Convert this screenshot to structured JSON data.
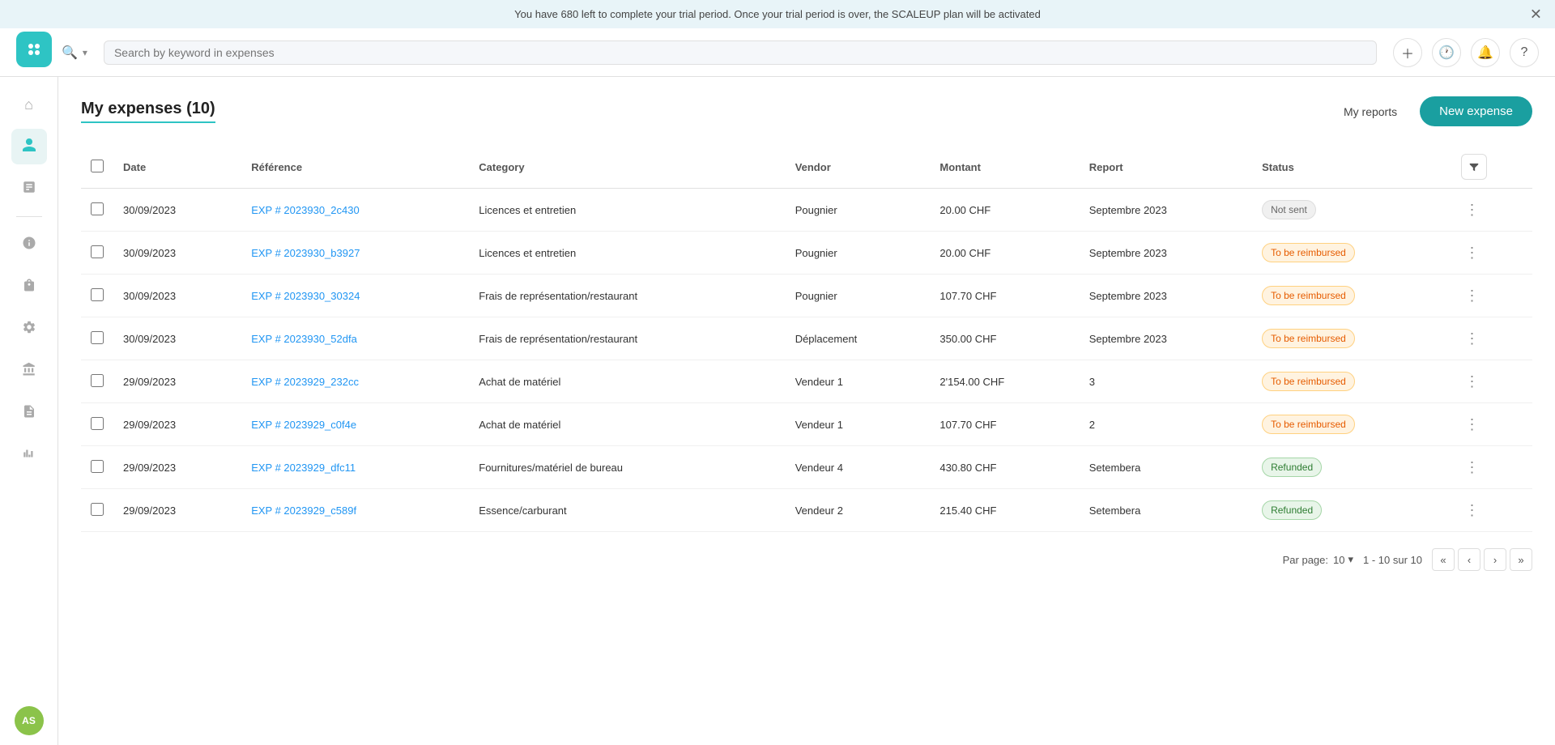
{
  "banner": {
    "message": "You have 680 left to complete your trial period. Once your trial period is over, the SCALEUP plan will be activated"
  },
  "header": {
    "search_placeholder": "Search by keyword in expenses"
  },
  "sidebar": {
    "logo_initials": "✦",
    "items": [
      {
        "id": "home",
        "icon": "🏠",
        "active": false
      },
      {
        "id": "users",
        "icon": "👤",
        "active": true
      },
      {
        "id": "reports",
        "icon": "📋",
        "active": false
      },
      {
        "id": "budget",
        "icon": "💰",
        "active": false
      },
      {
        "id": "bag",
        "icon": "🛍️",
        "active": false
      },
      {
        "id": "settings",
        "icon": "⚙️",
        "active": false
      },
      {
        "id": "bank",
        "icon": "🏦",
        "active": false
      },
      {
        "id": "docs",
        "icon": "📄",
        "active": false
      },
      {
        "id": "analytics",
        "icon": "📊",
        "active": false
      }
    ],
    "avatar": "AS"
  },
  "page": {
    "title": "My expenses (10)",
    "my_reports_label": "My reports",
    "new_expense_label": "New expense"
  },
  "table": {
    "columns": [
      "Date",
      "Référence",
      "Category",
      "Vendor",
      "Montant",
      "Report",
      "Status"
    ],
    "rows": [
      {
        "date": "30/09/2023",
        "reference": "EXP # 2023930_2c430",
        "category": "Licences et entretien",
        "vendor": "Pougnier",
        "amount": "20.00 CHF",
        "report": "Septembre 2023",
        "status": "Not sent",
        "status_type": "not-sent"
      },
      {
        "date": "30/09/2023",
        "reference": "EXP # 2023930_b3927",
        "category": "Licences et entretien",
        "vendor": "Pougnier",
        "amount": "20.00 CHF",
        "report": "Septembre 2023",
        "status": "To be reimbursed",
        "status_type": "to-be-reimbursed"
      },
      {
        "date": "30/09/2023",
        "reference": "EXP # 2023930_30324",
        "category": "Frais de représentation/restaurant",
        "vendor": "Pougnier",
        "amount": "107.70 CHF",
        "report": "Septembre 2023",
        "status": "To be reimbursed",
        "status_type": "to-be-reimbursed"
      },
      {
        "date": "30/09/2023",
        "reference": "EXP # 2023930_52dfa",
        "category": "Frais de représentation/restaurant",
        "vendor": "Déplacement",
        "amount": "350.00 CHF",
        "report": "Septembre 2023",
        "status": "To be reimbursed",
        "status_type": "to-be-reimbursed"
      },
      {
        "date": "29/09/2023",
        "reference": "EXP # 2023929_232cc",
        "category": "Achat de matériel",
        "vendor": "Vendeur 1",
        "amount": "2'154.00 CHF",
        "report": "3",
        "status": "To be reimbursed",
        "status_type": "to-be-reimbursed"
      },
      {
        "date": "29/09/2023",
        "reference": "EXP # 2023929_c0f4e",
        "category": "Achat de matériel",
        "vendor": "Vendeur 1",
        "amount": "107.70 CHF",
        "report": "2",
        "status": "To be reimbursed",
        "status_type": "to-be-reimbursed"
      },
      {
        "date": "29/09/2023",
        "reference": "EXP # 2023929_dfc11",
        "category": "Fournitures/matériel de bureau",
        "vendor": "Vendeur 4",
        "amount": "430.80 CHF",
        "report": "Setembera",
        "status": "Refunded",
        "status_type": "refunded"
      },
      {
        "date": "29/09/2023",
        "reference": "EXP # 2023929_c589f",
        "category": "Essence/carburant",
        "vendor": "Vendeur 2",
        "amount": "215.40 CHF",
        "report": "Setembera",
        "status": "Refunded",
        "status_type": "refunded"
      }
    ]
  },
  "pagination": {
    "per_page_label": "Par page:",
    "per_page_value": "10",
    "range_label": "1 - 10 sur 10"
  }
}
